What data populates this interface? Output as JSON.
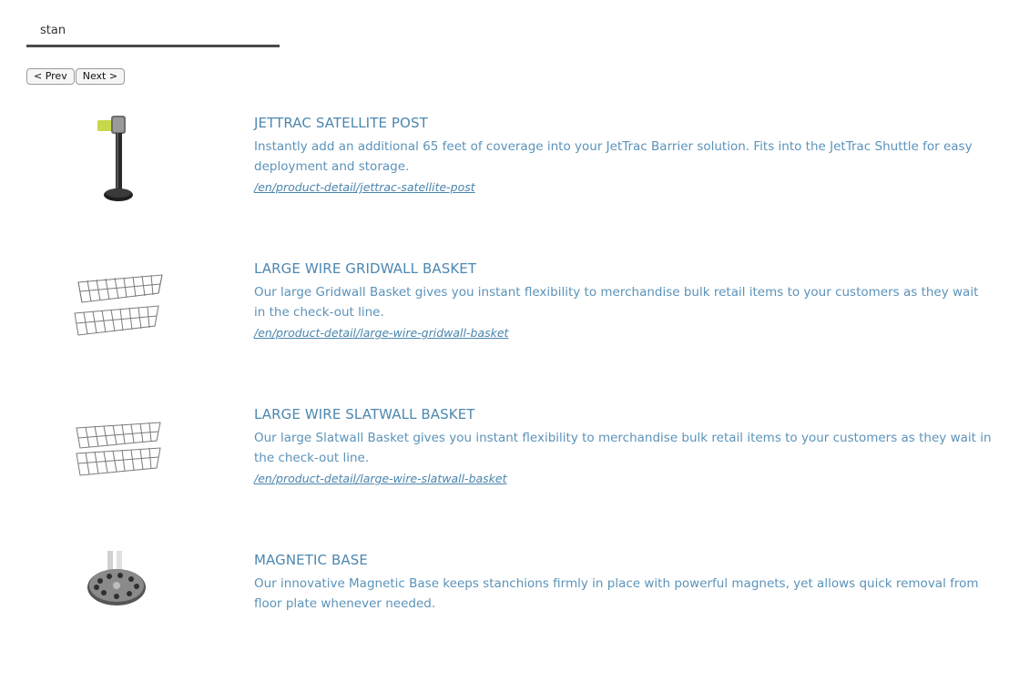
{
  "search": {
    "value": "stan"
  },
  "pager": {
    "prev_label": "< Prev",
    "next_label": "Next >"
  },
  "results": [
    {
      "title": "JETTRAC SATELLITE POST",
      "description": "Instantly add an additional 65 feet of coverage into your JetTrac Barrier solution. Fits into the JetTrac Shuttle for easy deployment and storage.",
      "url": "/en/product-detail/jettrac-satellite-post",
      "image": "stanchion-post-image"
    },
    {
      "title": "LARGE WIRE GRIDWALL BASKET",
      "description": "Our large Gridwall Basket gives you instant flexibility to merchandise bulk retail items to your customers as they wait in the check-out line.",
      "url": "/en/product-detail/large-wire-gridwall-basket",
      "image": "wire-basket-image"
    },
    {
      "title": "LARGE WIRE SLATWALL BASKET",
      "description": "Our large Slatwall Basket gives you instant flexibility to merchandise bulk retail items to your customers as they wait in the check-out line.",
      "url": "/en/product-detail/large-wire-slatwall-basket",
      "image": "wire-basket-image"
    },
    {
      "title": "MAGNETIC BASE",
      "description": "Our innovative Magnetic Base keeps stanchions firmly in place with powerful magnets, yet allows quick removal from floor plate whenever needed.",
      "url": "",
      "image": "magnetic-base-image"
    }
  ],
  "colors": {
    "link": "#4d87b0",
    "text": "#5b93b9",
    "search_underline": "#4a4a4a"
  }
}
